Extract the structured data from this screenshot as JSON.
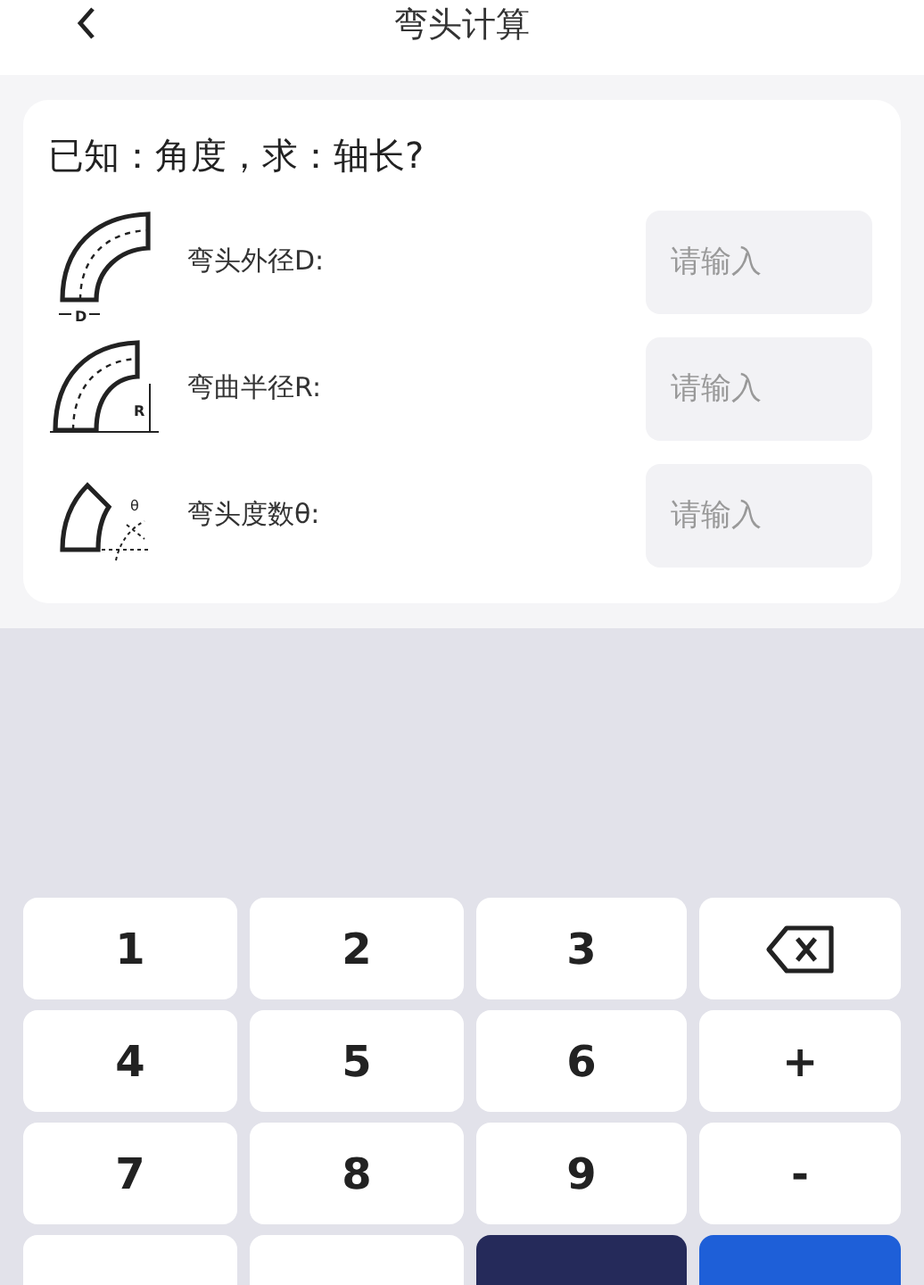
{
  "header": {
    "title": "弯头计算"
  },
  "card": {
    "question": "已知：角度，求：轴长?",
    "fields": [
      {
        "label": "弯头外径D:",
        "placeholder": "请输入",
        "kind": "diameter",
        "figure_text": "D"
      },
      {
        "label": "弯曲半径R:",
        "placeholder": "请输入",
        "kind": "radius",
        "figure_text": "R"
      },
      {
        "label": "弯头度数θ:",
        "placeholder": "请输入",
        "kind": "angle",
        "figure_text": "θ"
      }
    ]
  },
  "keypad": [
    {
      "kind": "text",
      "label": "1"
    },
    {
      "kind": "text",
      "label": "2"
    },
    {
      "kind": "text",
      "label": "3"
    },
    {
      "kind": "backspace"
    },
    {
      "kind": "text",
      "label": "4"
    },
    {
      "kind": "text",
      "label": "5"
    },
    {
      "kind": "text",
      "label": "6"
    },
    {
      "kind": "text",
      "label": "+"
    },
    {
      "kind": "text",
      "label": "7"
    },
    {
      "kind": "text",
      "label": "8"
    },
    {
      "kind": "text",
      "label": "9"
    },
    {
      "kind": "text",
      "label": "-"
    },
    {
      "kind": "blank"
    },
    {
      "kind": "blank"
    },
    {
      "kind": "dark"
    },
    {
      "kind": "primary"
    }
  ]
}
